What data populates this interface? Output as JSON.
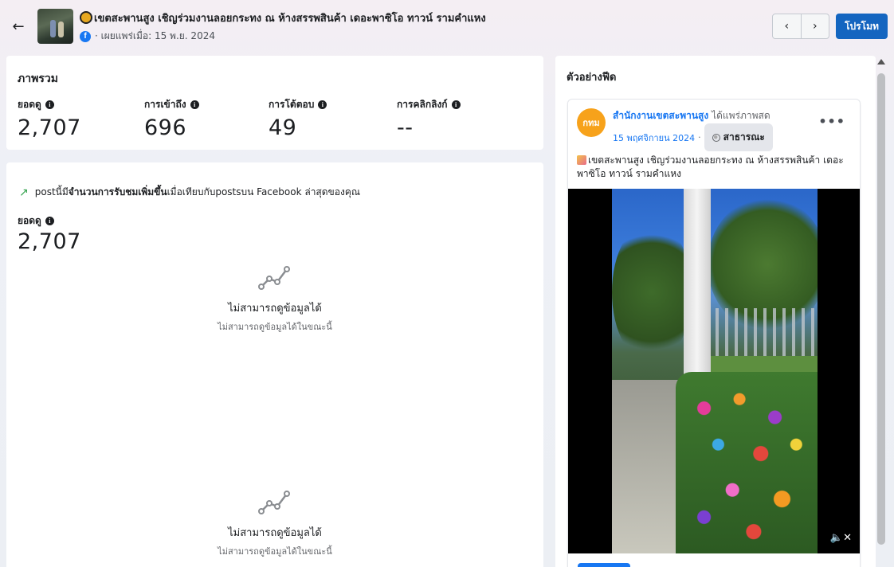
{
  "header": {
    "back_label": "←",
    "title": "เขตสะพานสูง เชิญร่วมงานลอยกระทง ณ ห้างสรรพสินค้า เดอะพาซิโอ ทาวน์ รามคำแหง",
    "platform_icon": "facebook-icon",
    "published": "· เผยแพร่เมื่อ: 15 พ.ย. 2024",
    "prev_icon": "‹",
    "next_icon": "›",
    "promote_label": "โปรโมท"
  },
  "overview": {
    "title": "ภาพรวม",
    "metrics": [
      {
        "label": "ยอดดู",
        "value": "2,707"
      },
      {
        "label": "การเข้าถึง",
        "value": "696"
      },
      {
        "label": "การโต้ตอบ",
        "value": "49"
      },
      {
        "label": "การคลิกลิงก์",
        "value": "--"
      }
    ]
  },
  "insights": {
    "trend_prefix": "postนี้มี",
    "trend_bold": "จำนวนการรับชมเพิ่มขึ้น",
    "trend_suffix": "เมื่อเทียบกับpostsบน Facebook ล่าสุดของคุณ",
    "views_label": "ยอดดู",
    "views_value": "2,707",
    "empty_states": [
      {
        "title": "ไม่สามารถดูข้อมูลได้",
        "subtitle": "ไม่สามารถดูข้อมูลได้ในขณะนี้"
      },
      {
        "title": "ไม่สามารถดูข้อมูลได้",
        "subtitle": "ไม่สามารถดูข้อมูลได้ในขณะนี้"
      }
    ]
  },
  "preview": {
    "title": "ตัวอย่างฟีด",
    "avatar_text": "กทม",
    "page_name": "สำนักงานเขตสะพานสูง",
    "page_action": "ได้แพร่ภาพสด",
    "date": "15 พฤศจิกายน 2024",
    "dot": "·",
    "privacy": "สาธารณะ",
    "more": "•••",
    "post_text": "เขตสะพานสูง เชิญร่วมงานลอยกระทง ณ ห้างสรรพสินค้า เดอะพาซิโอ ทาวน์ รามคำแหง",
    "mute_icon": "🔈✕"
  },
  "colors": {
    "accent": "#1465c0",
    "facebook_blue": "#1877f2",
    "trend_green": "#31a24c"
  }
}
